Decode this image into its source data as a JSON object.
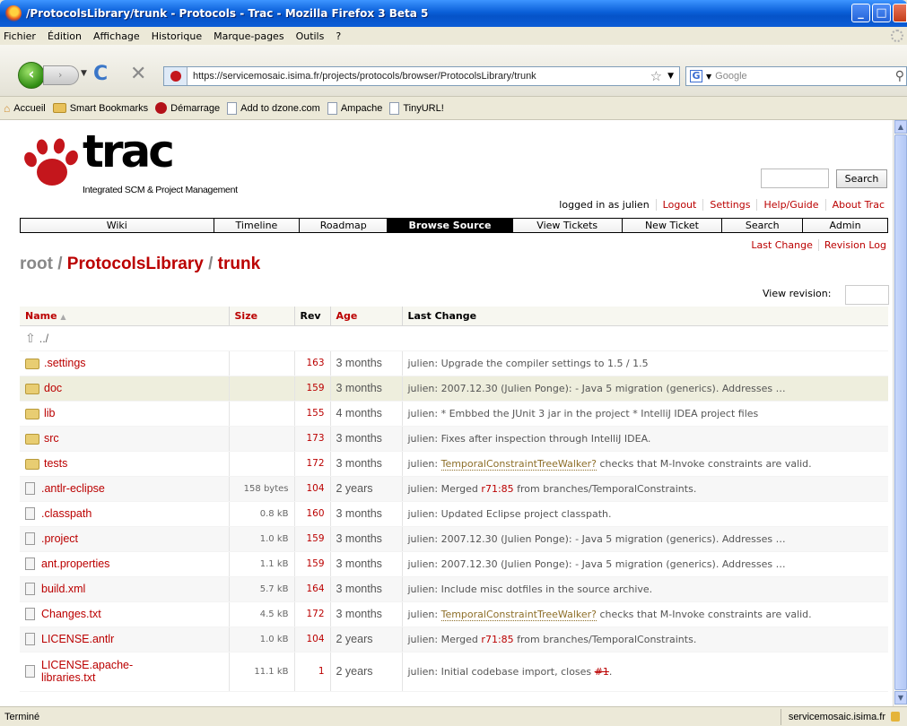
{
  "window": {
    "title": "/ProtocolsLibrary/trunk - Protocols - Trac - Mozilla Firefox 3 Beta 5",
    "buttons": {
      "minimize": "_",
      "maximize": "□",
      "close": "✕"
    }
  },
  "menu": [
    "Fichier",
    "Édition",
    "Affichage",
    "Historique",
    "Marque-pages",
    "Outils",
    "?"
  ],
  "toolbar": {
    "url": "https://servicemosaic.isima.fr/projects/protocols/browser/ProtocolsLibrary/trunk",
    "search_placeholder": "Google"
  },
  "bookmarks": [
    "Accueil",
    "Smart Bookmarks",
    "Démarrage",
    "Add to dzone.com",
    "Ampache",
    "TinyURL!"
  ],
  "trac": {
    "logo_word": "trac",
    "logo_subtitle": "Integrated SCM & Project Management",
    "search_button": "Search",
    "metanav": [
      "logged in as julien",
      "Logout",
      "Settings",
      "Help/Guide",
      "About Trac"
    ],
    "mainnav": [
      "Wiki",
      "Timeline",
      "Roadmap",
      "Browse Source",
      "View Tickets",
      "New Ticket",
      "Search",
      "Admin"
    ],
    "mainnav_active": "Browse Source",
    "ctxtnav": [
      "Last Change",
      "Revision Log"
    ],
    "path": {
      "root": "root",
      "sep": "/",
      "seg1": "ProtocolsLibrary",
      "seg2": "trunk"
    },
    "view_revision_label": "View revision:",
    "columns": {
      "name": "Name",
      "size": "Size",
      "rev": "Rev",
      "age": "Age",
      "last_change": "Last Change"
    },
    "parent_dir": "../",
    "rows": [
      {
        "name": ".settings",
        "type": "dir",
        "size": "",
        "rev": "163",
        "age": "3 months",
        "author": "julien:",
        "message": "Upgrade the compiler settings to 1.5 / 1.5"
      },
      {
        "name": "doc",
        "type": "dir",
        "size": "",
        "rev": "159",
        "age": "3 months",
        "author": "julien:",
        "message": "2007.12.30 (Julien Ponge): - Java 5 migration (generics). Addresses …"
      },
      {
        "name": "lib",
        "type": "dir",
        "size": "",
        "rev": "155",
        "age": "4 months",
        "author": "julien:",
        "message": "* Embbed the JUnit 3 jar in the project * IntelliJ IDEA project files"
      },
      {
        "name": "src",
        "type": "dir",
        "size": "",
        "rev": "173",
        "age": "3 months",
        "author": "julien:",
        "message": "Fixes after inspection through IntelliJ IDEA."
      },
      {
        "name": "tests",
        "type": "dir",
        "size": "",
        "rev": "172",
        "age": "3 months",
        "author": "julien:",
        "wikilink": "TemporalConstraintTreeWalker?",
        "message": " checks that M-Invoke constraints are valid."
      },
      {
        "name": ".antlr-eclipse",
        "type": "file",
        "size": "158 bytes",
        "rev": "104",
        "age": "2 years",
        "author": "julien:",
        "message_pre": "Merged ",
        "changeset": "r71:85",
        "message": " from branches/TemporalConstraints."
      },
      {
        "name": ".classpath",
        "type": "file",
        "size": "0.8 kB",
        "rev": "160",
        "age": "3 months",
        "author": "julien:",
        "message": "Updated Eclipse project classpath."
      },
      {
        "name": ".project",
        "type": "file",
        "size": "1.0 kB",
        "rev": "159",
        "age": "3 months",
        "author": "julien:",
        "message": "2007.12.30 (Julien Ponge): - Java 5 migration (generics). Addresses …"
      },
      {
        "name": "ant.properties",
        "type": "file",
        "size": "1.1 kB",
        "rev": "159",
        "age": "3 months",
        "author": "julien:",
        "message": "2007.12.30 (Julien Ponge): - Java 5 migration (generics). Addresses …"
      },
      {
        "name": "build.xml",
        "type": "file",
        "size": "5.7 kB",
        "rev": "164",
        "age": "3 months",
        "author": "julien:",
        "message": "Include misc dotfiles in the source archive."
      },
      {
        "name": "Changes.txt",
        "type": "file",
        "size": "4.5 kB",
        "rev": "172",
        "age": "3 months",
        "author": "julien:",
        "wikilink": "TemporalConstraintTreeWalker?",
        "message": " checks that M-Invoke constraints are valid."
      },
      {
        "name": "LICENSE.antlr",
        "type": "file",
        "size": "1.0 kB",
        "rev": "104",
        "age": "2 years",
        "author": "julien:",
        "message_pre": "Merged ",
        "changeset": "r71:85",
        "message": " from branches/TemporalConstraints."
      },
      {
        "name": "LICENSE.apache-libraries.txt",
        "type": "file",
        "size": "11.1 kB",
        "rev": "1",
        "age": "2 years",
        "author": "julien:",
        "message_pre": "Initial codebase import, closes ",
        "ticket": "#1",
        "message": "."
      }
    ]
  },
  "status": {
    "left": "Terminé",
    "right": "servicemosaic.isima.fr"
  }
}
